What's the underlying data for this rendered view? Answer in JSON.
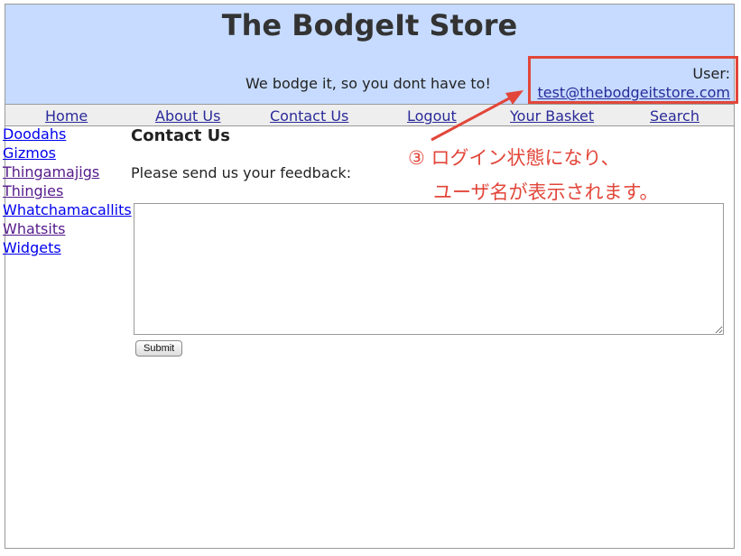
{
  "header": {
    "title": "The BodgeIt Store",
    "tagline": "We bodge it, so you dont have to!",
    "user_label": "User:",
    "user_email": "test@thebodgeitstore.com"
  },
  "nav": {
    "items": [
      "Home",
      "About Us",
      "Contact Us",
      "Logout",
      "Your Basket",
      "Search"
    ]
  },
  "sidebar": {
    "items": [
      "Doodahs",
      "Gizmos",
      "Thingamajigs",
      "Thingies",
      "Whatchamacallits",
      "Whatsits",
      "Widgets"
    ]
  },
  "main": {
    "heading": "Contact Us",
    "prompt": "Please send us your feedback:",
    "feedback_value": "",
    "submit_label": "Submit"
  },
  "annotation": {
    "line1": "③ ログイン状態になり、",
    "line2": "ユーザ名が表示されます。",
    "color": "#e2463a"
  },
  "colors": {
    "header_bg": "#c6dbff",
    "nav_bg": "#eeeeee",
    "link": "#0000ee",
    "visited_link": "#551a8b"
  }
}
